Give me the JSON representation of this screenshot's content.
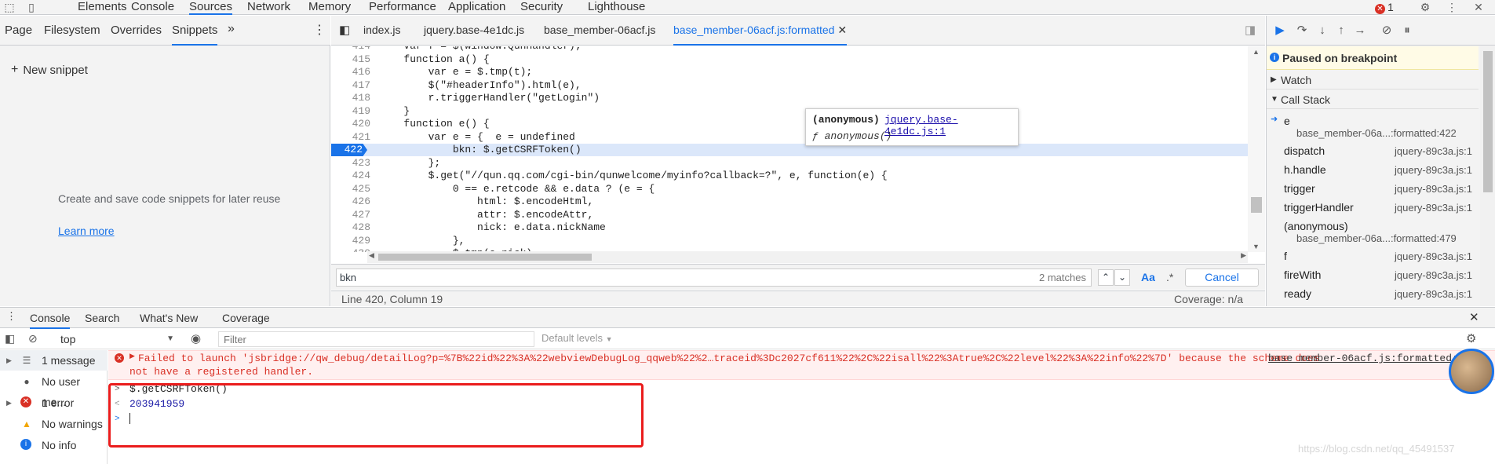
{
  "topbar": {
    "tabs": [
      "Elements",
      "Console",
      "Sources",
      "Network",
      "Memory",
      "Performance",
      "Application",
      "Security",
      "Lighthouse"
    ],
    "error_count": "1"
  },
  "navigator": {
    "tabs": [
      "Page",
      "Filesystem",
      "Overrides",
      "Snippets"
    ],
    "more": "»",
    "new_snippet": "New snippet",
    "empty_text": "Create and save code snippets for later reuse",
    "learn_more": "Learn more"
  },
  "editor": {
    "tabs": [
      "index.js",
      "jquery.base-4e1dc.js",
      "base_member-06acf.js",
      "base_member-06acf.js:formatted"
    ],
    "lines": [
      {
        "n": "414",
        "t": "        var f = $(window.QunHandler);"
      },
      {
        "n": "415",
        "t": "        function a() {"
      },
      {
        "n": "416",
        "t": "            var e = $.tmp(t);"
      },
      {
        "n": "417",
        "t": "            $(\"#headerInfo\").html(e),"
      },
      {
        "n": "418",
        "t": "            r.triggerHandler(\"getLogin\")"
      },
      {
        "n": "419",
        "t": "        }"
      },
      {
        "n": "420",
        "t": "        function e() {"
      },
      {
        "n": "421",
        "t": "            var e = {  e = undefined"
      },
      {
        "n": "422",
        "t": "                bkn: $.getCSRFToken()"
      },
      {
        "n": "423",
        "t": "            };"
      },
      {
        "n": "424",
        "t": "            $.get(\"//qun.qq.com/cgi-bin/qunwelcome/myinfo?callback=?\", e, function(e) {"
      },
      {
        "n": "425",
        "t": "                0 == e.retcode && e.data ? (e = {"
      },
      {
        "n": "426",
        "t": "                    html: $.encodeHtml,"
      },
      {
        "n": "427",
        "t": "                    attr: $.encodeAttr,"
      },
      {
        "n": "428",
        "t": "                    nick: e.data.nickName"
      },
      {
        "n": "429",
        "t": "                },"
      },
      {
        "n": "430",
        "t": "                $.tmp(e.nick)"
      }
    ],
    "popover": {
      "title": "(anonymous)",
      "link": "jquery.base-4e1dc.js:1",
      "fn": "ƒ anonymous()"
    },
    "search": {
      "query": "bkn",
      "matches": "2 matches",
      "case": "Aa",
      "regex": ".*",
      "cancel": "Cancel"
    },
    "status": {
      "position": "Line 420, Column 19",
      "coverage": "Coverage: n/a"
    }
  },
  "debugger": {
    "paused": "Paused on breakpoint",
    "watch": "Watch",
    "callstack": "Call Stack",
    "frames": [
      {
        "fn": "e",
        "loc": "base_member-06a...:formatted:422",
        "two": true,
        "current": true
      },
      {
        "fn": "dispatch",
        "loc": "jquery-89c3a.js:1"
      },
      {
        "fn": "h.handle",
        "loc": "jquery-89c3a.js:1"
      },
      {
        "fn": "trigger",
        "loc": "jquery-89c3a.js:1"
      },
      {
        "fn": "triggerHandler",
        "loc": "jquery-89c3a.js:1"
      },
      {
        "fn": "(anonymous)",
        "loc": "base_member-06a...:formatted:479",
        "two": true
      },
      {
        "fn": "f",
        "loc": "jquery-89c3a.js:1"
      },
      {
        "fn": "fireWith",
        "loc": "jquery-89c3a.js:1"
      },
      {
        "fn": "ready",
        "loc": "jquery-89c3a.js:1"
      }
    ]
  },
  "drawer": {
    "tabs": [
      "Console",
      "Search",
      "What's New",
      "Coverage"
    ],
    "context": "top",
    "filter_placeholder": "Filter",
    "levels": "Default levels"
  },
  "sidebar": [
    {
      "label": "1 message",
      "icon": "list-icon"
    },
    {
      "label": "No user me...",
      "icon": "user-icon"
    },
    {
      "label": "1 error",
      "icon": "error-icon"
    },
    {
      "label": "No warnings",
      "icon": "warning-icon"
    },
    {
      "label": "No info",
      "icon": "info-icon"
    }
  ],
  "console": {
    "error_line1": "Failed to launch 'jsbridge://qw_debug/detailLog?p=%7B%22id%22%3A%22webviewDebugLog_qqweb%22%2…traceid%3Dc2027cf611%22%2C%22isall%22%3Atrue%2C%22level%22%3A%22info%22%7D' because the scheme does",
    "error_line2": "not have a registered handler.",
    "error_source": "base_member-06acf.js:formatted:",
    "input": "$.getCSRFToken()",
    "result": "203941959"
  },
  "watermark": "https://blog.csdn.net/qq_45491537",
  "colors": {
    "accent": "#1a73e8",
    "error": "#d93025",
    "highlight_box": "#ea1c1c"
  }
}
